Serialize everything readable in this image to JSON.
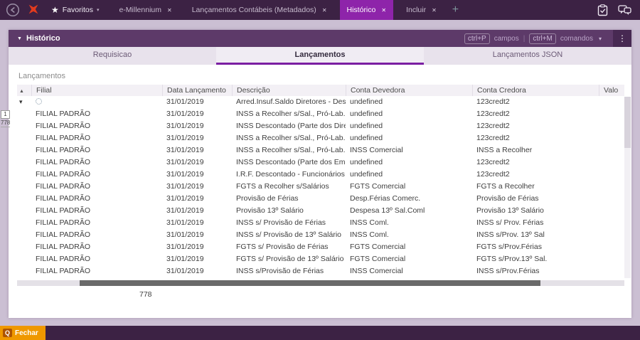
{
  "topbar": {
    "favorites_label": "Favoritos",
    "tabs": [
      {
        "label": "e-Millennium",
        "active": false
      },
      {
        "label": "Lançamentos Contábeis (Metadados)",
        "active": false
      },
      {
        "label": "Histórico",
        "active": true
      },
      {
        "label": "Incluir",
        "active": false
      }
    ]
  },
  "panel": {
    "title": "Histórico",
    "shortcut_fields_key": "ctrl+P",
    "shortcut_fields_label": "campos",
    "shortcut_divider": "|",
    "shortcut_commands_key": "ctrl+M",
    "shortcut_commands_label": "comandos",
    "tabs": [
      {
        "label": "Requisicao",
        "active": false
      },
      {
        "label": "Lançamentos",
        "active": true
      },
      {
        "label": "Lançamentos JSON",
        "active": false
      }
    ]
  },
  "grid": {
    "section_label": "Lançamentos",
    "columns": [
      "Filial",
      "Data Lançamento",
      "Descrição",
      "Conta Devedora",
      "Conta Credora",
      "Valo"
    ],
    "pager_index": "1",
    "pager_total": "778",
    "footer_total": "778",
    "rows": [
      {
        "filial": "",
        "date": "31/01/2019",
        "desc": "Arred.Insuf.Saldo Diretores - Descontos",
        "debit": "undefined",
        "credit": "123credt2",
        "value": ""
      },
      {
        "filial": "FILIAL PADRÃO",
        "date": "31/01/2019",
        "desc": "INSS a Recolher s/Sal., Pró-Lab. e Aut.",
        "debit": "undefined",
        "credit": "123credt2",
        "value": ""
      },
      {
        "filial": "FILIAL PADRÃO",
        "date": "31/01/2019",
        "desc": "INSS Descontado (Parte dos Diretores)",
        "debit": "undefined",
        "credit": "123credt2",
        "value": ""
      },
      {
        "filial": "FILIAL PADRÃO",
        "date": "31/01/2019",
        "desc": "INSS a Recolher s/Sal., Pró-Lab. e Aut.",
        "debit": "undefined",
        "credit": "123credt2",
        "value": ""
      },
      {
        "filial": "FILIAL PADRÃO",
        "date": "31/01/2019",
        "desc": "INSS a Recolher s/Sal., Pró-Lab. e Aut.",
        "debit": "INSS Comercial",
        "credit": "INSS a Recolher",
        "value": ""
      },
      {
        "filial": "FILIAL PADRÃO",
        "date": "31/01/2019",
        "desc": "INSS Descontado (Parte dos Empregados)",
        "debit": "undefined",
        "credit": "123credt2",
        "value": ""
      },
      {
        "filial": "FILIAL PADRÃO",
        "date": "31/01/2019",
        "desc": "I.R.F. Descontado - Funcionários",
        "debit": "undefined",
        "credit": "123credt2",
        "value": ""
      },
      {
        "filial": "FILIAL PADRÃO",
        "date": "31/01/2019",
        "desc": "FGTS a Recolher s/Salários",
        "debit": "FGTS Comercial",
        "credit": "FGTS a Recolher",
        "value": ""
      },
      {
        "filial": "FILIAL PADRÃO",
        "date": "31/01/2019",
        "desc": "Provisão de Férias",
        "debit": "Desp.Férias Comerc.",
        "credit": "Provisão de Férias",
        "value": ""
      },
      {
        "filial": "FILIAL PADRÃO",
        "date": "31/01/2019",
        "desc": "Provisão 13º Salário",
        "debit": "Despesa 13º Sal.Coml",
        "credit": "Provisão 13º Salário",
        "value": ""
      },
      {
        "filial": "FILIAL PADRÃO",
        "date": "31/01/2019",
        "desc": "INSS s/ Provisão de Férias",
        "debit": "INSS Coml.",
        "credit": "INSS s/ Prov. Férias",
        "value": ""
      },
      {
        "filial": "FILIAL PADRÃO",
        "date": "31/01/2019",
        "desc": "INSS s/ Provisão de 13º Salário",
        "debit": "INSS Coml.",
        "credit": "INSS s/Prov. 13º Sal",
        "value": ""
      },
      {
        "filial": "FILIAL PADRÃO",
        "date": "31/01/2019",
        "desc": "FGTS s/ Provisão de Férias",
        "debit": "FGTS Comercial",
        "credit": "FGTS s/Prov.Férias",
        "value": ""
      },
      {
        "filial": "FILIAL PADRÃO",
        "date": "31/01/2019",
        "desc": "FGTS s/ Provisão de 13º Salário",
        "debit": "FGTS Comercial",
        "credit": "FGTS s/Prov.13º Sal.",
        "value": ""
      },
      {
        "filial": "FILIAL PADRÃO",
        "date": "31/01/2019",
        "desc": "INSS s/Provisão de Férias",
        "debit": "INSS Comercial",
        "credit": "INSS s/Prov.Férias",
        "value": ""
      }
    ]
  },
  "footer": {
    "close_key": "Q",
    "close_label": "Fechar"
  }
}
